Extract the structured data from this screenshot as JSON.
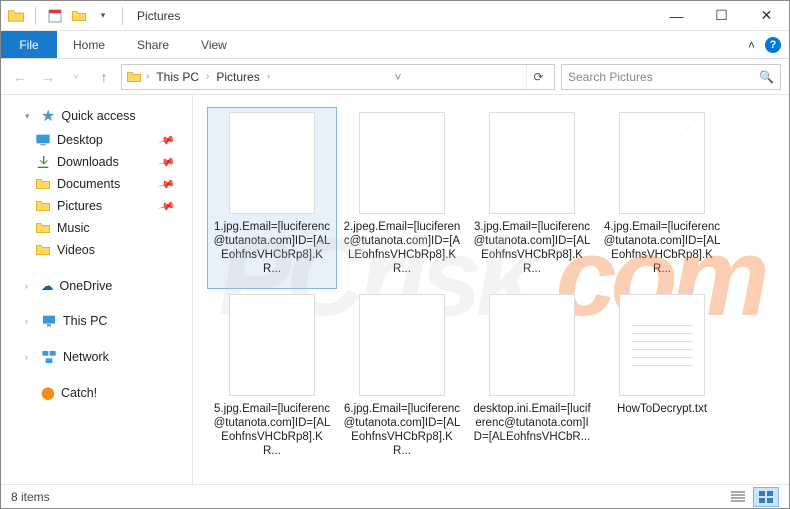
{
  "titlebar": {
    "title": "Pictures"
  },
  "window_controls": {
    "min": "—",
    "max": "☐",
    "close": "✕"
  },
  "ribbon": {
    "file": "File",
    "tabs": [
      "Home",
      "Share",
      "View"
    ]
  },
  "nav": {
    "back": "←",
    "forward": "→",
    "up": "↑",
    "refresh": "⟳"
  },
  "breadcrumb": {
    "root_icon": "folder",
    "items": [
      "This PC",
      "Pictures"
    ]
  },
  "search": {
    "placeholder": "Search Pictures"
  },
  "sidebar": {
    "quick_access": {
      "label": "Quick access"
    },
    "quick_items": [
      {
        "label": "Desktop",
        "pinned": true,
        "icon": "desktop"
      },
      {
        "label": "Downloads",
        "pinned": true,
        "icon": "downloads"
      },
      {
        "label": "Documents",
        "pinned": true,
        "icon": "documents"
      },
      {
        "label": "Pictures",
        "pinned": true,
        "icon": "pictures"
      },
      {
        "label": "Music",
        "pinned": false,
        "icon": "music"
      },
      {
        "label": "Videos",
        "pinned": false,
        "icon": "videos"
      }
    ],
    "onedrive": {
      "label": "OneDrive"
    },
    "thispc": {
      "label": "This PC"
    },
    "network": {
      "label": "Network"
    },
    "catch": {
      "label": "Catch!"
    }
  },
  "files": [
    {
      "name": "1.jpg.Email=[luciferenc@tutanota.com]ID=[ALEohfnsVHCbRp8].KR...",
      "selected": true,
      "type": "blank"
    },
    {
      "name": "2.jpeg.Email=[luciferenc@tutanota.com]ID=[ALEohfnsVHCbRp8].KR...",
      "selected": false,
      "type": "blank"
    },
    {
      "name": "3.jpg.Email=[luciferenc@tutanota.com]ID=[ALEohfnsVHCbRp8].KR...",
      "selected": false,
      "type": "blank"
    },
    {
      "name": "4.jpg.Email=[luciferenc@tutanota.com]ID=[ALEohfnsVHCbRp8].KR...",
      "selected": false,
      "type": "blank"
    },
    {
      "name": "5.jpg.Email=[luciferenc@tutanota.com]ID=[ALEohfnsVHCbRp8].KR...",
      "selected": false,
      "type": "blank"
    },
    {
      "name": "6.jpg.Email=[luciferenc@tutanota.com]ID=[ALEohfnsVHCbRp8].KR...",
      "selected": false,
      "type": "blank"
    },
    {
      "name": "desktop.ini.Email=[luciferenc@tutanota.com]ID=[ALEohfnsVHCbR...",
      "selected": false,
      "type": "blank"
    },
    {
      "name": "HowToDecrypt.txt",
      "selected": false,
      "type": "txt"
    }
  ],
  "status": {
    "text": "8 items"
  },
  "watermark": {
    "a": "PC",
    "b": "risk",
    "c": ".com"
  }
}
